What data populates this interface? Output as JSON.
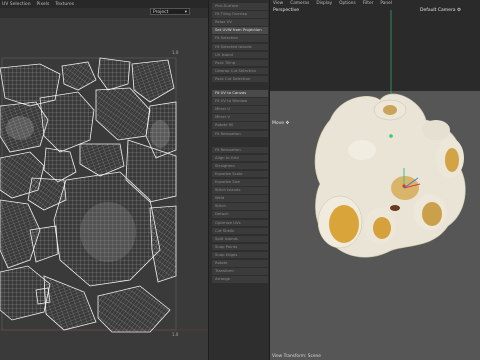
{
  "uv_editor": {
    "menu": [
      "UV Selection",
      "Pixels",
      "Textures"
    ],
    "mode": "Project",
    "corner_top": "1.0",
    "corner_bottom": "1.0"
  },
  "command_list": {
    "items": [
      {
        "label": "Pick-Surface"
      },
      {
        "label": "Fit Tiling Overlap"
      },
      {
        "label": "Relax UV"
      },
      {
        "label": "Set UVW from Projection",
        "bright": true
      },
      {
        "label": "Fit Selection"
      },
      {
        "label": "Fit Selected Islands"
      },
      {
        "label": "UV Island"
      },
      {
        "label": "Pack Tiling"
      },
      {
        "label": "Unwrap Cut Selection"
      },
      {
        "label": "Pack Cut Selection"
      },
      {
        "label": "Fit UV to Canvas",
        "bright": true
      },
      {
        "label": "Fit UV to Window"
      },
      {
        "label": "Mirror U"
      },
      {
        "label": "Mirror V"
      },
      {
        "label": "Rotate 90"
      },
      {
        "label": "Fit Relaxation"
      },
      {
        "label": "Fit Relaxation"
      },
      {
        "label": "Align to Grid"
      },
      {
        "label": "Straighten"
      },
      {
        "label": "Equalize Scale"
      },
      {
        "label": "Equalize Size"
      },
      {
        "label": "Stitch Islands"
      },
      {
        "label": "Weld"
      },
      {
        "label": "Stitch"
      },
      {
        "label": "Detach"
      },
      {
        "label": "Optimize UVs"
      },
      {
        "label": "Cut Shells"
      },
      {
        "label": "Split Islands"
      },
      {
        "label": "Snap Points"
      },
      {
        "label": "Snap Edges"
      },
      {
        "label": "Rotate"
      },
      {
        "label": "Transform"
      },
      {
        "label": "Arrange"
      }
    ]
  },
  "viewport": {
    "menu": [
      "View",
      "Cameras",
      "Display",
      "Options",
      "Filter",
      "Panel"
    ],
    "top_label": "Perspective",
    "camera": "Default Camera ⚙",
    "lower_label": "Move ✥",
    "status": "View Transform: Scene"
  },
  "colors": {
    "uv_line": "#dcdcdc",
    "uv_bg": "#3a3a3a",
    "object_body": "#e9e4d6",
    "object_shadow": "#d9a53b",
    "axis_green": "#3cc97a",
    "axis_red": "#d43b3b"
  }
}
